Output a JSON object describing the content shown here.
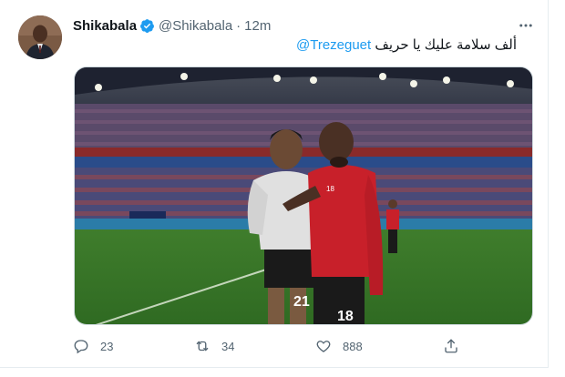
{
  "tweet": {
    "author_name": "Shikabala",
    "handle": "@Shikabala",
    "separator": "·",
    "time": "12m",
    "text_arabic": "ألف سلامة عليك يا حريف",
    "mention": "@Trezeguet",
    "verified": true
  },
  "image": {
    "jersey_left": "21",
    "jersey_right": "18",
    "chest_number": "18"
  },
  "actions": {
    "reply_count": "23",
    "retweet_count": "34",
    "like_count": "888"
  },
  "colors": {
    "accent": "#1d9bf0",
    "text": "#0f1419",
    "muted": "#536471"
  },
  "icons": [
    "verified-badge-icon",
    "more-icon",
    "reply-icon",
    "retweet-icon",
    "like-icon",
    "share-icon"
  ]
}
